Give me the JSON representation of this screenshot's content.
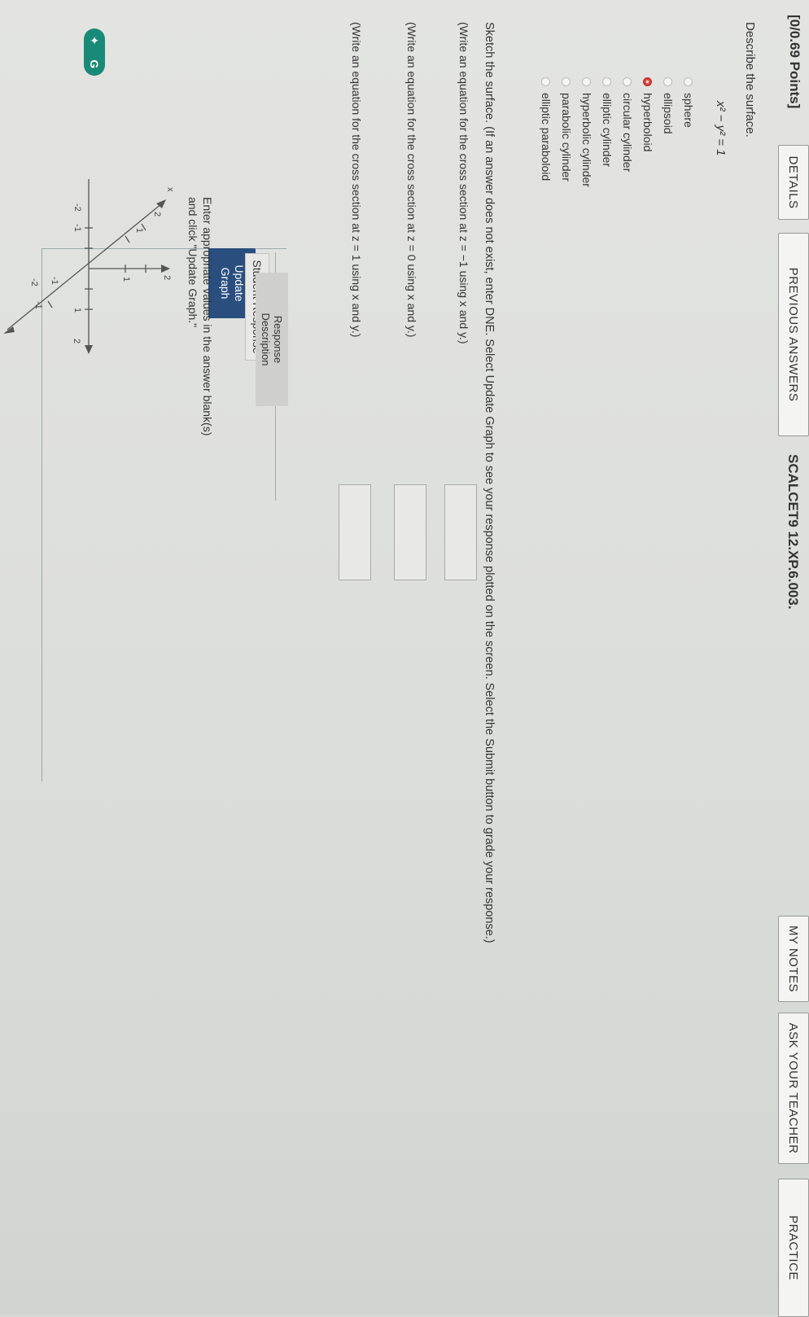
{
  "header": {
    "points": "[0/0.69 Points]",
    "details_button": "DETAILS",
    "previous_answers_button": "PREVIOUS ANSWERS",
    "problem_code": "SCALCET9 12.XP.6.003.",
    "my_notes_button": "MY NOTES",
    "ask_teacher_button": "ASK YOUR TEACHER",
    "practice_button": "PRACTICE"
  },
  "question": {
    "prompt": "Describe the surface.",
    "equation": "x² − y² = 1",
    "options": [
      {
        "label": "sphere",
        "selected": false
      },
      {
        "label": "ellipsoid",
        "selected": false
      },
      {
        "label": "hyperboloid",
        "selected": true
      },
      {
        "label": "circular cylinder",
        "selected": false
      },
      {
        "label": "elliptic cylinder",
        "selected": false
      },
      {
        "label": "hyperbolic cylinder",
        "selected": false
      },
      {
        "label": "parabolic cylinder",
        "selected": false
      },
      {
        "label": "elliptic paraboloid",
        "selected": false
      }
    ]
  },
  "sketch": {
    "instructions": "Sketch the surface. (If an answer does not exist, enter DNE. Select Update Graph to see your response plotted on the screen. Select the Submit button to grade your response.)",
    "cross_sections": [
      "(Write an equation for the cross section at z = −1 using x and y.)",
      "(Write an equation for the cross section at z = 0 using x and y.)",
      "(Write an equation for the cross section at z = 1 using x and y.)"
    ]
  },
  "graph_panel": {
    "update_button_line1": "Update",
    "update_button_line2": "Graph",
    "tab_student": "Student Response",
    "tab_description_line1": "Response",
    "tab_description_line2": "Description",
    "hint_line1": "Enter appropriate values in the answer blank(s)",
    "hint_line2": "and click \"Update Graph.\"",
    "axis_labels": {
      "x": "x",
      "z_top": "2",
      "y_right": "2"
    },
    "ticks": [
      "2",
      "1",
      "-1",
      "-2",
      "1",
      "-1",
      "-2",
      "1",
      "-1",
      "2"
    ]
  },
  "extension_badge": "G"
}
